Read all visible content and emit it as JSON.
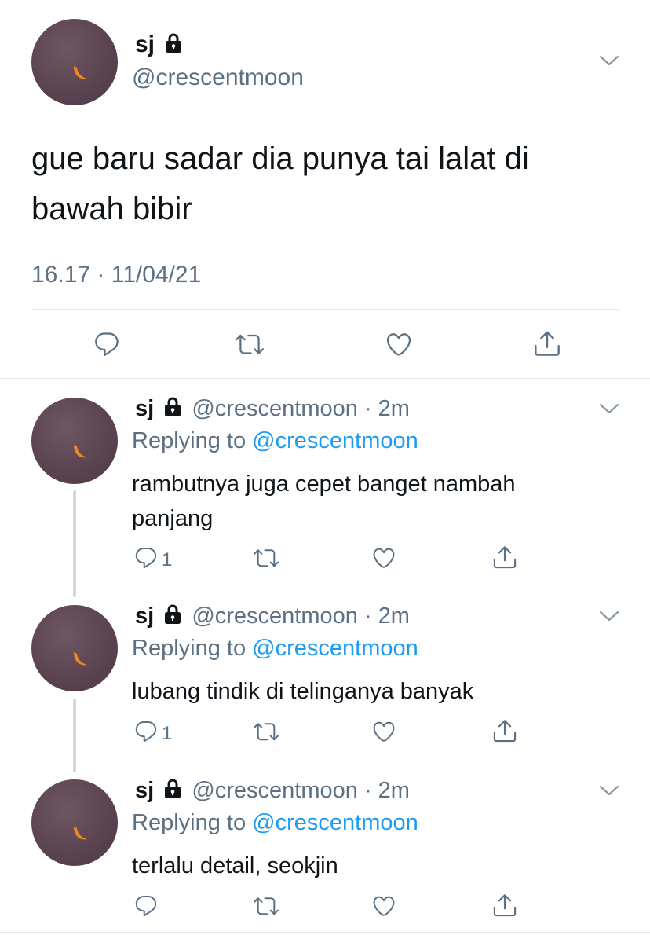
{
  "main_tweet": {
    "display_name": "sj",
    "handle": "@crescentmoon",
    "text_line1": "gue baru sadar dia punya tai lalat di",
    "text_line2": "bawah bibir",
    "timestamp": "16.17 · 11/04/21"
  },
  "replies": [
    {
      "display_name": "sj",
      "handle": "@crescentmoon",
      "time": "· 2m",
      "replying_prefix": "Replying to",
      "replying_to": "@crescentmoon",
      "text_line1": "rambutnya juga cepet banget nambah",
      "text_line2": "panjang",
      "reply_count": "1"
    },
    {
      "display_name": "sj",
      "handle": "@crescentmoon",
      "time": "· 2m",
      "replying_prefix": "Replying to",
      "replying_to": "@crescentmoon",
      "text_line1": "lubang tindik di telinganya banyak",
      "reply_count": "1"
    },
    {
      "display_name": "sj",
      "handle": "@crescentmoon",
      "time": "· 2m",
      "replying_prefix": "Replying to",
      "replying_to": "@crescentmoon",
      "text_line1": "terlalu detail, seokjin"
    }
  ],
  "colors": {
    "text": "#0f1419",
    "secondary": "#5b7083",
    "link": "#1d9bf0",
    "divider": "#e1e8ed",
    "avatar": "#5a4350"
  },
  "icons": [
    "lock-icon",
    "chevron-down-icon",
    "reply-icon",
    "retweet-icon",
    "like-icon",
    "share-icon",
    "crescent-moon-avatar"
  ]
}
